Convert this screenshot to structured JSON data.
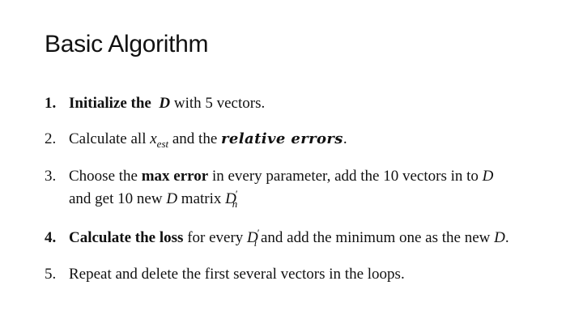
{
  "slide": {
    "title": "Basic Algorithm",
    "items": [
      {
        "number": "1.",
        "parts": {
          "a": "Initialize the",
          "b": "D",
          "c": "with 5 vectors."
        }
      },
      {
        "number": "2.",
        "parts": {
          "a": "Calculate all",
          "x": "x",
          "x_sub": "est",
          "b": "and the",
          "c": "relative errors",
          "d": "."
        }
      },
      {
        "number": "3.",
        "parts": {
          "a": "Choose the",
          "b": "max error",
          "c": "in every parameter, add the 10 vectors in to",
          "d": "D",
          "e": "and get 10 new",
          "f": "D",
          "g": "matrix",
          "h": "D",
          "h_prime": "′",
          "h_sub": "n"
        }
      },
      {
        "number": "4.",
        "parts": {
          "a": "Calculate the loss",
          "b": "for every",
          "c": "D",
          "c_prime": "′",
          "c_sub": "i",
          "d": "and add the minimum one as the new",
          "e": "D",
          "f": "."
        }
      },
      {
        "number": "5.",
        "parts": {
          "a": "Repeat and delete the first several vectors in the loops."
        }
      }
    ]
  }
}
